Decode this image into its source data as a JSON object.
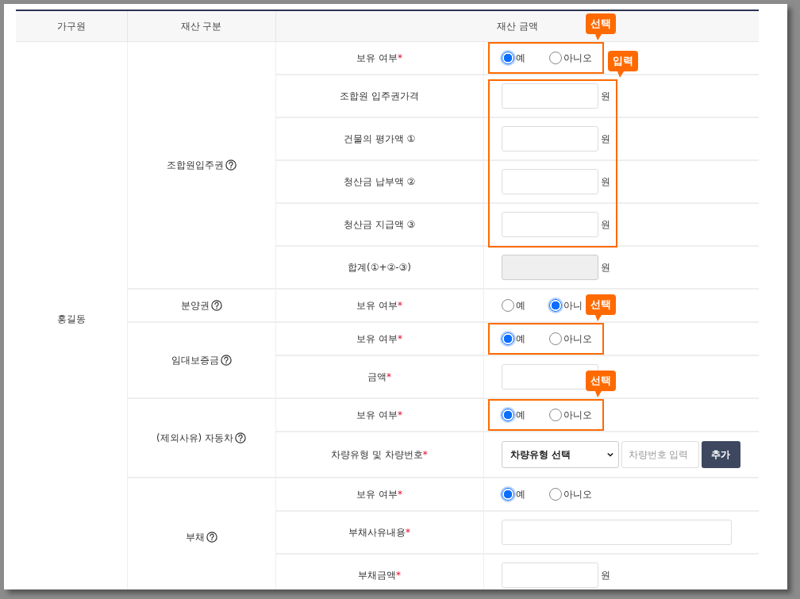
{
  "header": [
    "가구원",
    "재산 구분",
    "재산 금액"
  ],
  "member": "홍길동",
  "groups": [
    {
      "name": "조합원입주권",
      "help": true,
      "rows": [
        {
          "kind": "radio",
          "label": "보유 여부",
          "mark": "*",
          "outlined": true,
          "callout": "선택",
          "options": [
            {
              "label": "예",
              "selected": true
            },
            {
              "label": "아니오",
              "selected": false
            }
          ]
        },
        {
          "kind": "highlight-group",
          "callout": "입력",
          "rows": [
            {
              "kind": "amount",
              "label": "조합원 입주권가격",
              "unit": "원",
              "disabled": false
            },
            {
              "kind": "amount",
              "label": "건물의 평가액 ①",
              "unit": "원",
              "disabled": false
            },
            {
              "kind": "amount",
              "label": "청산금 납부액 ②",
              "unit": "원",
              "disabled": false
            },
            {
              "kind": "amount",
              "label": "청산금 지급액 ③",
              "unit": "원",
              "disabled": false
            }
          ]
        },
        {
          "kind": "amount",
          "label": "합계(①+②-③)",
          "unit": "원",
          "disabled": true
        }
      ]
    },
    {
      "name": "분양권",
      "help": true,
      "rows": [
        {
          "kind": "radio",
          "label": "보유 여부",
          "mark": "*",
          "outlined": false,
          "options": [
            {
              "label": "예",
              "selected": false
            },
            {
              "label": "아니",
              "selected": true
            }
          ]
        }
      ]
    },
    {
      "name": "임대보증금",
      "help": true,
      "rows": [
        {
          "kind": "radio",
          "label": "보유 여부",
          "mark": "*",
          "outlined": true,
          "callout": "선택",
          "options": [
            {
              "label": "예",
              "selected": true
            },
            {
              "label": "아니오",
              "selected": false
            }
          ]
        },
        {
          "kind": "amount",
          "label": "금액",
          "mark": "*",
          "disabled": false
        }
      ]
    },
    {
      "name": "(제외사유) 자동차",
      "help": true,
      "rows": [
        {
          "kind": "radio",
          "label": "보유 여부",
          "mark": "*",
          "outlined": true,
          "callout": "선택",
          "options": [
            {
              "label": "예",
              "selected": true
            },
            {
              "label": "아니오",
              "selected": false
            }
          ]
        },
        {
          "kind": "vehicle",
          "label": "차량유형 및 차량번호",
          "mark": "*",
          "select": "차량유형 선택",
          "placeholder": "차량번호 입력",
          "button": "추가"
        }
      ]
    },
    {
      "name": "부채",
      "help": true,
      "rows": [
        {
          "kind": "radio",
          "label": "보유 여부",
          "mark": "*",
          "outlined": false,
          "options": [
            {
              "label": "예",
              "selected": true
            },
            {
              "label": "아니오",
              "selected": false
            }
          ]
        },
        {
          "kind": "text",
          "label": "부채사유내용",
          "mark": "*"
        },
        {
          "kind": "amount",
          "label": "부채금액",
          "mark": "*",
          "unit": "원",
          "disabled": false
        }
      ]
    }
  ]
}
